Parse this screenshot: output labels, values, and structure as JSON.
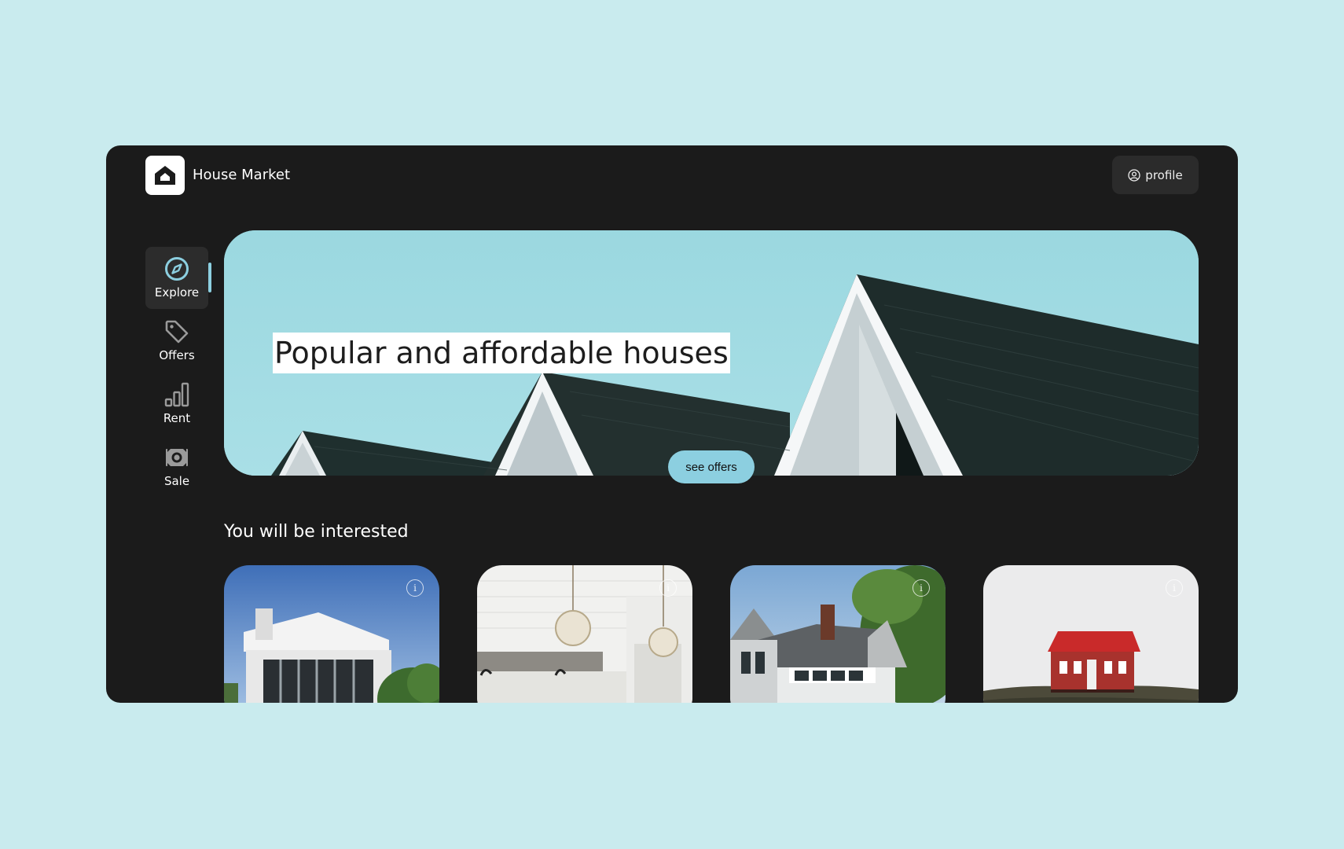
{
  "app": {
    "name": "House Market",
    "profile_label": "profile"
  },
  "sidebar": {
    "items": [
      {
        "label": "Explore",
        "icon": "compass-icon",
        "active": true
      },
      {
        "label": "Offers",
        "icon": "tag-icon",
        "active": false
      },
      {
        "label": "Rent",
        "icon": "bar-chart-icon",
        "active": false
      },
      {
        "label": "Sale",
        "icon": "cash-icon",
        "active": false
      }
    ]
  },
  "hero": {
    "title": "Popular and affordable houses",
    "button_label": "see offers"
  },
  "recommendations": {
    "title": "You will be interested",
    "cards": [
      {
        "image": "modern-white-villa"
      },
      {
        "image": "white-kitchen-interior"
      },
      {
        "image": "grey-suburban-house"
      },
      {
        "image": "small-red-cabin"
      }
    ]
  },
  "colors": {
    "background": "#c9ebee",
    "panel": "#1b1b1b",
    "accent": "#8ccfe0"
  }
}
